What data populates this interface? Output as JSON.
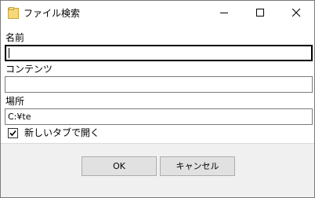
{
  "window": {
    "title": "ファイル検索",
    "icon": "folder-icon",
    "controls": [
      "minimize-icon",
      "maximize-icon",
      "close-icon"
    ]
  },
  "form": {
    "name_label": "名前",
    "name_value": "",
    "contents_label": "コンテンツ",
    "contents_value": "",
    "location_label": "場所",
    "location_value": "C:¥te",
    "new_tab_label": "新しいタブで開く",
    "new_tab_checked": true
  },
  "buttons": {
    "ok_label": "OK",
    "cancel_label": "キャンセル"
  },
  "colors": {
    "title_bar": "#ffffff",
    "dialog_background": "#f0f0f0",
    "button_face": "#e1e1e1",
    "field_border": "#7a7a7a"
  }
}
